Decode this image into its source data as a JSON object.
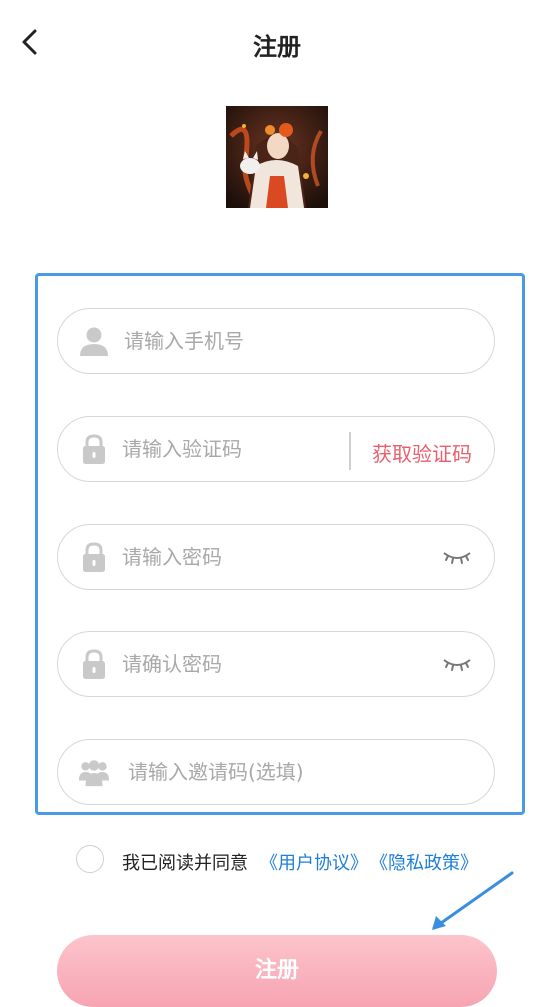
{
  "header": {
    "title": "注册"
  },
  "form": {
    "phone_placeholder": "请输入手机号",
    "code_placeholder": "请输入验证码",
    "get_code_label": "获取验证码",
    "password_placeholder": "请输入密码",
    "confirm_placeholder": "请确认密码",
    "invite_placeholder": "请输入邀请码(选填)"
  },
  "agreement": {
    "text": "我已阅读并同意",
    "user_agreement": "《用户协议》",
    "privacy_policy": "《隐私政策》"
  },
  "register_button": "注册",
  "icons": {
    "back": "chevron-left-icon",
    "user": "user-icon",
    "lock": "lock-icon",
    "eye": "eye-closed-icon",
    "group": "group-icon",
    "arrow": "arrow-icon"
  },
  "colors": {
    "accent_blue": "#4a9ae6",
    "link": "#1e7fd8",
    "get_code": "#e8606d",
    "button": "#f7a4b2"
  }
}
